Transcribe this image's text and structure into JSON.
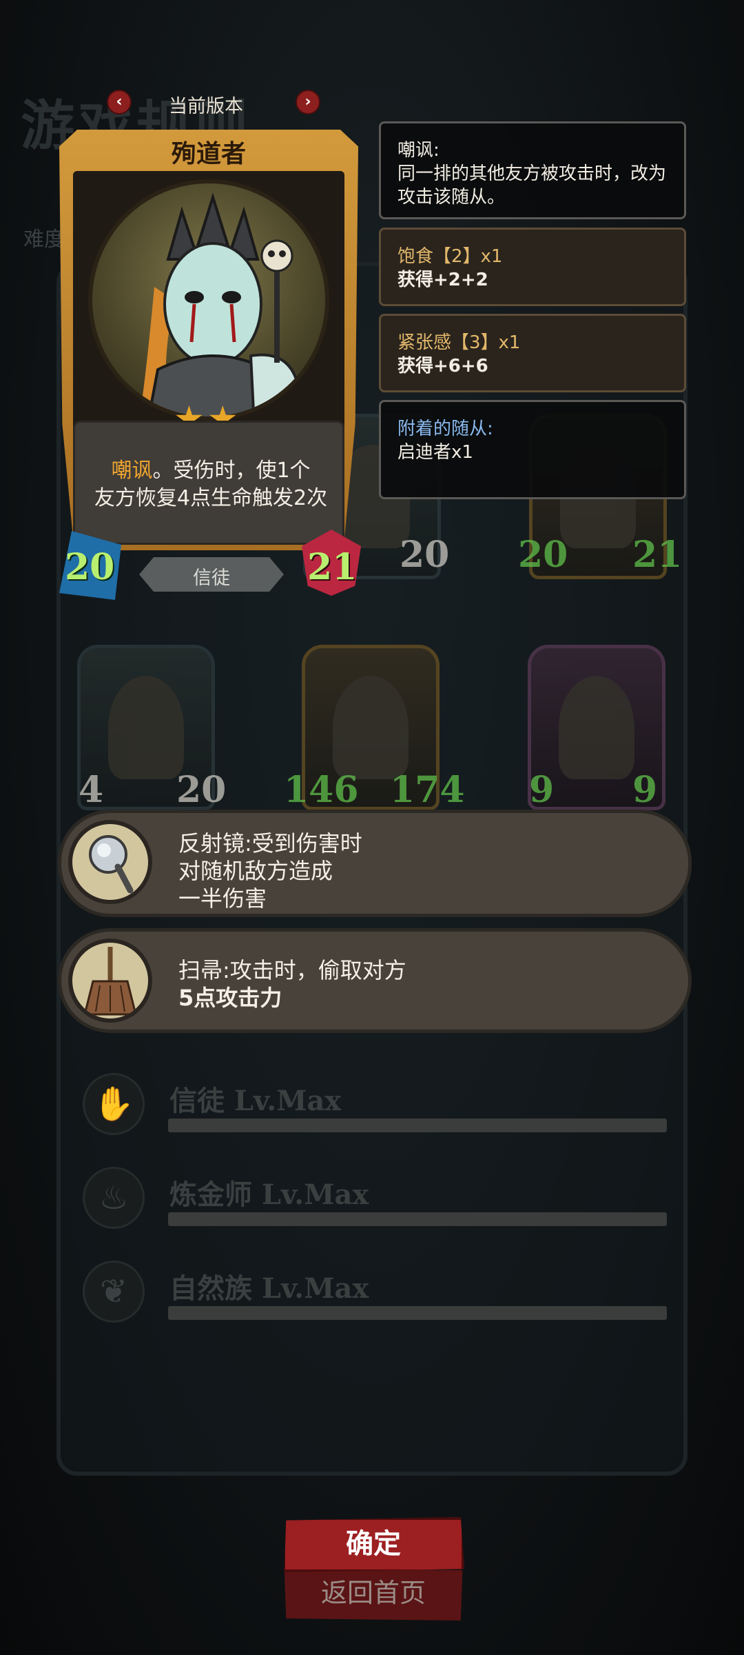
{
  "background": {
    "title": "游戏规则",
    "subtitle": "难度",
    "version_label": "当前版本",
    "grid_cards": [
      {
        "atk": "20",
        "hp": "20"
      },
      {
        "atk": "20",
        "hp": "21"
      },
      {
        "atk": "4",
        "hp": "20"
      },
      {
        "atk": "146",
        "hp": "174"
      },
      {
        "atk": "9",
        "hp": "9"
      }
    ],
    "classes": [
      {
        "name": "信徒 Lv.Max",
        "icon": "praying-hands-icon"
      },
      {
        "name": "炼金师 Lv.Max",
        "icon": "alchemy-icon"
      },
      {
        "name": "自然族 Lv.Max",
        "icon": "nature-icon"
      }
    ]
  },
  "card": {
    "name": "殉道者",
    "stars": "★★",
    "description_keyword": "嘲讽",
    "description_line1_rest": "。受伤时，使1个",
    "description_line2": "友方恢复4点生命触发2次",
    "attack": "20",
    "health": "21",
    "tribe": "信徒"
  },
  "panels": {
    "taunt": {
      "title": "嘲讽:",
      "body": "同一排的其他友方被攻击时，改为攻击该随从。"
    },
    "buff1": {
      "title": "饱食【2】x1",
      "body": "获得+2+2"
    },
    "buff2": {
      "title": "紧张感【3】x1",
      "body": "获得+6+6"
    },
    "attached": {
      "title": "附着的随从:",
      "body": "启迪者x1"
    }
  },
  "items": [
    {
      "icon": "mirror-icon",
      "lines": [
        "反射镜:受到伤害时",
        "对随机敌方造成",
        "一半伤害"
      ]
    },
    {
      "icon": "broom-icon",
      "lines": [
        "扫帚:攻击时，偷取对方",
        "5点攻击力"
      ]
    }
  ],
  "buttons": {
    "confirm": "确定",
    "home": "返回首页"
  },
  "colors": {
    "card_frame": "#d39a3c",
    "keyword": "#f0a62f",
    "attached_title": "#8ab9ef",
    "confirm_button": "#9c1f21",
    "stat_number": "#b9ef6f"
  }
}
